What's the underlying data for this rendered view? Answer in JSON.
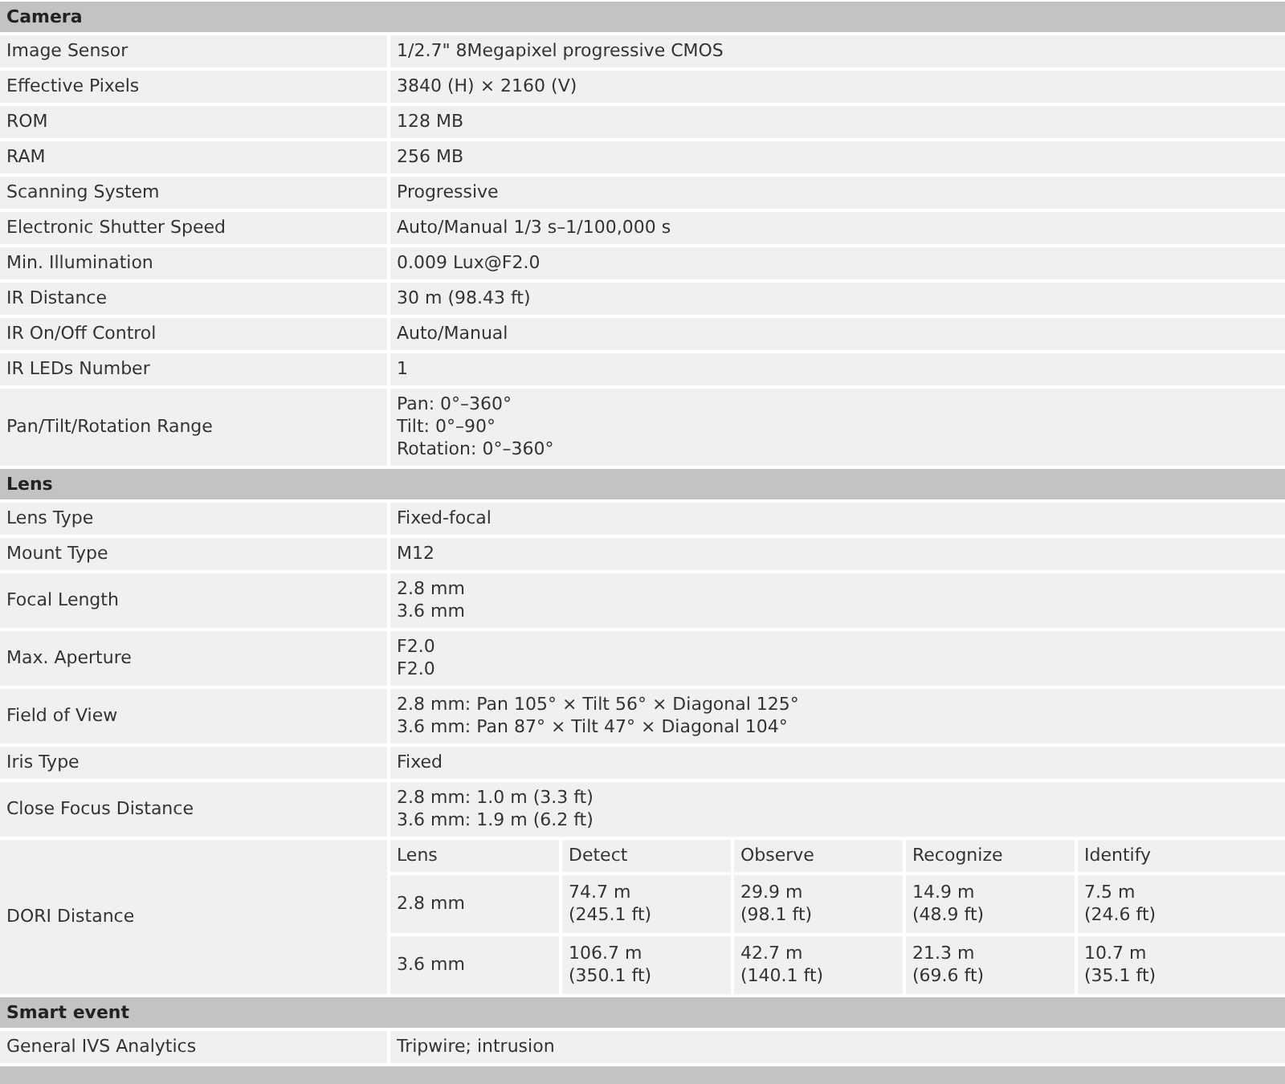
{
  "sections": [
    {
      "title": "Camera",
      "rows": [
        {
          "kind": "text",
          "label": "Image Sensor",
          "lines": [
            "1/2.7\" 8Megapixel progressive CMOS"
          ]
        },
        {
          "kind": "text",
          "label": "Effective Pixels",
          "lines": [
            "3840 (H) × 2160 (V)"
          ]
        },
        {
          "kind": "text",
          "label": "ROM",
          "lines": [
            "128 MB"
          ]
        },
        {
          "kind": "text",
          "label": "RAM",
          "lines": [
            "256 MB"
          ]
        },
        {
          "kind": "text",
          "label": "Scanning System",
          "lines": [
            "Progressive"
          ]
        },
        {
          "kind": "text",
          "label": "Electronic Shutter Speed",
          "lines": [
            "Auto/Manual 1/3 s–1/100,000 s"
          ]
        },
        {
          "kind": "text",
          "label": "Min. Illumination",
          "lines": [
            "0.009 Lux@F2.0"
          ]
        },
        {
          "kind": "text",
          "label": "IR Distance",
          "lines": [
            "30 m (98.43 ft)"
          ]
        },
        {
          "kind": "text",
          "label": "IR On/Off Control",
          "lines": [
            "Auto/Manual"
          ]
        },
        {
          "kind": "text",
          "label": "IR LEDs Number",
          "lines": [
            "1"
          ]
        },
        {
          "kind": "text",
          "label": "Pan/Tilt/Rotation Range",
          "lines": [
            "Pan: 0°–360°",
            "Tilt: 0°–90°",
            "Rotation: 0°–360°"
          ]
        }
      ]
    },
    {
      "title": "Lens",
      "rows": [
        {
          "kind": "text",
          "label": "Lens Type",
          "lines": [
            "Fixed-focal"
          ]
        },
        {
          "kind": "text",
          "label": "Mount Type",
          "lines": [
            "M12"
          ]
        },
        {
          "kind": "text",
          "label": "Focal Length",
          "lines": [
            "2.8 mm",
            "3.6 mm"
          ]
        },
        {
          "kind": "text",
          "label": "Max. Aperture",
          "lines": [
            "F2.0",
            "F2.0"
          ]
        },
        {
          "kind": "text",
          "label": "Field of View",
          "lines": [
            "2.8 mm: Pan 105° × Tilt 56° × Diagonal 125°",
            "3.6 mm: Pan 87° × Tilt 47° × Diagonal 104°"
          ]
        },
        {
          "kind": "text",
          "label": "Iris Type",
          "lines": [
            "Fixed"
          ]
        },
        {
          "kind": "text",
          "label": "Close Focus Distance",
          "lines": [
            "2.8 mm: 1.0 m (3.3 ft)",
            "3.6 mm: 1.9 m (6.2 ft)"
          ]
        },
        {
          "kind": "dori",
          "label": "DORI Distance",
          "table": {
            "columns": [
              "Lens",
              "Detect",
              "Observe",
              "Recognize",
              "Identify"
            ],
            "rows": [
              [
                [
                  "2.8 mm"
                ],
                [
                  "74.7 m",
                  "(245.1 ft)"
                ],
                [
                  "29.9 m",
                  "(98.1 ft)"
                ],
                [
                  "14.9 m",
                  "(48.9 ft)"
                ],
                [
                  "7.5 m",
                  "(24.6 ft)"
                ]
              ],
              [
                [
                  "3.6 mm"
                ],
                [
                  "106.7 m",
                  "(350.1 ft)"
                ],
                [
                  "42.7 m",
                  "(140.1 ft)"
                ],
                [
                  "21.3 m",
                  "(69.6 ft)"
                ],
                [
                  "10.7 m",
                  "(35.1 ft)"
                ]
              ]
            ]
          }
        }
      ]
    },
    {
      "title": "Smart event",
      "rows": [
        {
          "kind": "text",
          "label": "General IVS Analytics",
          "lines": [
            "Tripwire; intrusion"
          ]
        }
      ]
    }
  ]
}
